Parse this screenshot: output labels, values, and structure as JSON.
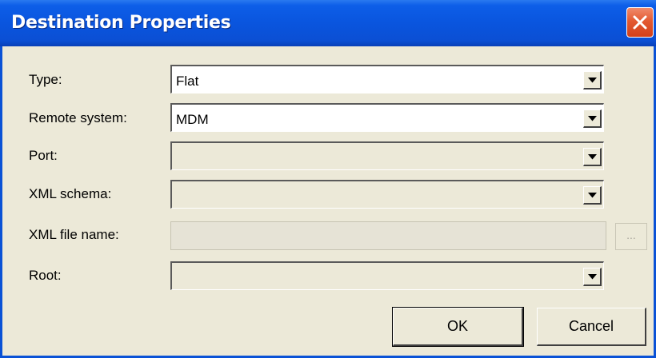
{
  "window": {
    "title": "Destination Properties",
    "close_icon": "close-icon"
  },
  "form": {
    "type": {
      "label": "Type:",
      "value": "Flat"
    },
    "remote_system": {
      "label": "Remote system:",
      "value": "MDM"
    },
    "port": {
      "label": "Port:",
      "value": ""
    },
    "xml_schema": {
      "label": "XML schema:",
      "value": ""
    },
    "xml_file_name": {
      "label": "XML file name:",
      "value": "",
      "browse_label": "..."
    },
    "root": {
      "label": "Root:",
      "value": ""
    }
  },
  "buttons": {
    "ok_label": "OK",
    "cancel_label": "Cancel"
  },
  "colors": {
    "titlebar": "#0a55de",
    "dialog_bg": "#ece9d8",
    "close_button": "#e35a32"
  }
}
